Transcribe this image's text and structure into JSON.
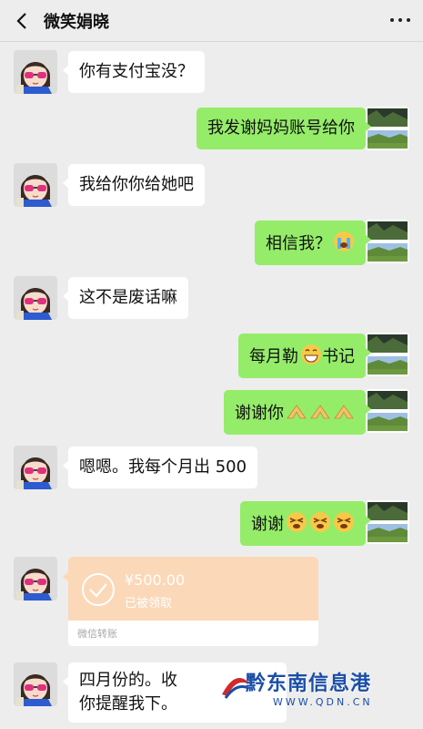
{
  "header": {
    "title": "微笑娟晓"
  },
  "messages": [
    {
      "side": "left",
      "text": "你有支付宝没？"
    },
    {
      "side": "right",
      "text": "我发谢妈妈账号给你"
    },
    {
      "side": "left",
      "text": "我给你你给她吧"
    },
    {
      "side": "right",
      "text": "相信我？"
    },
    {
      "side": "left",
      "text": "这不是废话嘛"
    },
    {
      "side": "right",
      "text_before": "每月勒",
      "text_after": "书记"
    },
    {
      "side": "right",
      "text": "谢谢你"
    },
    {
      "side": "left",
      "text": "嗯嗯。我每个月出 500"
    },
    {
      "side": "right",
      "text": "谢谢"
    }
  ],
  "transfer": {
    "amount": "¥500.00",
    "status": "已被领取",
    "footer": "微信转账"
  },
  "last_message": {
    "line1": "四月份的。收",
    "line2": "你提醒我下。"
  },
  "watermark": {
    "name": "黔东南信息港",
    "url": "WWW.QDN.CN"
  },
  "colors": {
    "background": "#ededed",
    "green_bubble": "#95ec69",
    "transfer_orange": "#fbd8b8"
  }
}
